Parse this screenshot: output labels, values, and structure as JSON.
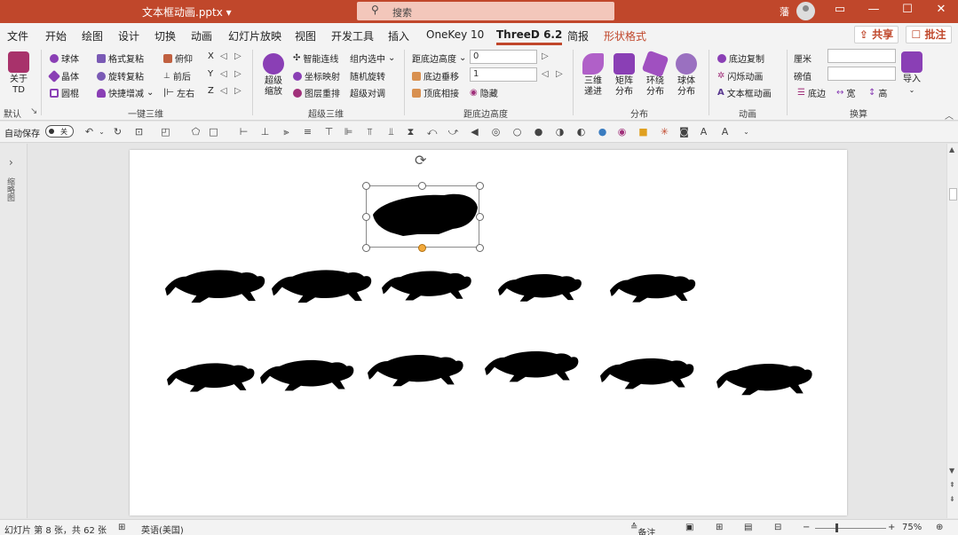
{
  "titlebar": {
    "doc_title": "文本框动画.pptx ▾",
    "search_placeholder": "搜索",
    "user": "藩",
    "icons": [
      "search-icon",
      "ribbon-display-icon",
      "minimize-icon",
      "maximize-icon",
      "close-icon"
    ]
  },
  "tabs": [
    "文件",
    "开始",
    "绘图",
    "设计",
    "切换",
    "动画",
    "幻灯片放映",
    "视图",
    "开发工具",
    "插入",
    "OneKey 10",
    "ThreeD 6.2",
    "简报",
    "形状格式"
  ],
  "active_tab": "ThreeD 6.2",
  "share_label": "共享",
  "comment_label": "批注",
  "ribbon": {
    "about": "关于\nTD",
    "about_l1": "关于",
    "about_l2": "TD",
    "default_label": "默认",
    "g1": {
      "sphere": "球体",
      "crystal": "晶体",
      "rounded": "圆棍",
      "format_copy": "格式复粘",
      "rotate_copy": "旋转复粘",
      "quick_add": "快捷增减",
      "pitch": "俯仰",
      "front_back": "前后",
      "left_right": "左右",
      "x": "X",
      "y": "Y",
      "z": "Z",
      "label": "一键三维"
    },
    "g2": {
      "super_zoom_l1": "超级",
      "super_zoom_l2": "缩放",
      "smart_connect": "智能连线",
      "coord_map": "坐标映射",
      "layer_arrange": "图层重排",
      "group_select": "组内选中",
      "random_rotate": "随机旋转",
      "super_align": "超级对调",
      "label": "超级三维"
    },
    "g3": {
      "bottom_height": "距底边高度",
      "value1": "0",
      "value2": "1",
      "bottom_shift": "底边垂移",
      "top_bottom": "顶底相接",
      "hide": "隐藏",
      "label": "距底边高度"
    },
    "g4": {
      "progressive_l1": "三维",
      "progressive_l2": "递进",
      "matrix_l1": "矩阵",
      "matrix_l2": "分布",
      "around_l1": "环绕",
      "around_l2": "分布",
      "sphere_l1": "球体",
      "sphere_l2": "分布",
      "label": "分布"
    },
    "g5": {
      "bottom_copy": "底边复制",
      "flash_anim": "闪烁动画",
      "textbox_anim": "文本框动画",
      "label": "动画"
    },
    "g6": {
      "cm": "厘米",
      "pound": "磅值",
      "bottom": "底边",
      "width": "宽",
      "height": "高",
      "import": "导入",
      "label": "换算"
    }
  },
  "qat": {
    "autosave": "自动保存",
    "toggle": "关"
  },
  "left_pane_label": "缩略图",
  "statusbar": {
    "slide_info": "幻灯片 第 8 张，共 62 张",
    "language": "英语(美国)",
    "notes": "备注",
    "zoom": "75%"
  }
}
